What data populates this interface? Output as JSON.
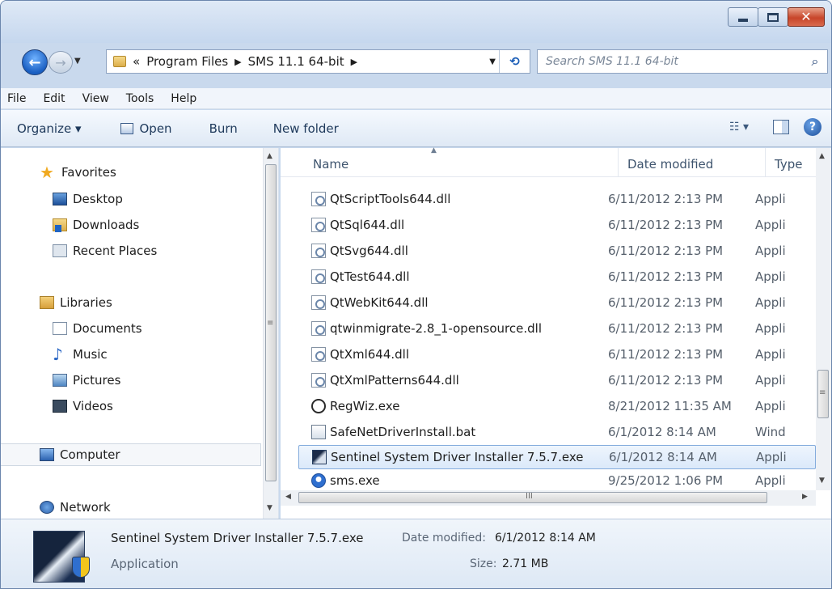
{
  "window": {
    "caption": {
      "minimize": "",
      "maximize": "",
      "close": "✕"
    }
  },
  "nav": {
    "back_glyph": "←",
    "forward_glyph": "→",
    "history_dropdown": "▼",
    "breadcrumb": {
      "overflow": "«",
      "items": [
        "Program Files",
        "SMS 11.1 64-bit"
      ],
      "separator": "▶"
    },
    "address_dropdown": "▼",
    "refresh_glyph": "⟲",
    "search_placeholder": "Search SMS 11.1 64-bit",
    "search_icon": "⌕"
  },
  "menu": {
    "items": [
      "File",
      "Edit",
      "View",
      "Tools",
      "Help"
    ]
  },
  "commands": {
    "organize": "Organize ▾",
    "open": "Open",
    "burn": "Burn",
    "new_folder": "New folder",
    "views_glyph": "☷ ▾",
    "help_glyph": "?"
  },
  "sidebar": {
    "favorites": {
      "label": "Favorites",
      "items": [
        "Desktop",
        "Downloads",
        "Recent Places"
      ]
    },
    "libraries": {
      "label": "Libraries",
      "items": [
        "Documents",
        "Music",
        "Pictures",
        "Videos"
      ]
    },
    "computer": "Computer",
    "network": "Network",
    "scroll_handle": "≡"
  },
  "files": {
    "columns": {
      "name": "Name",
      "date": "Date modified",
      "type": "Type"
    },
    "rows": [
      {
        "name": "QtScriptTools644.dll",
        "date": "6/11/2012 2:13 PM",
        "type": "Appli",
        "icon": "dll-icon"
      },
      {
        "name": "QtSql644.dll",
        "date": "6/11/2012 2:13 PM",
        "type": "Appli",
        "icon": "dll-icon"
      },
      {
        "name": "QtSvg644.dll",
        "date": "6/11/2012 2:13 PM",
        "type": "Appli",
        "icon": "dll-icon"
      },
      {
        "name": "QtTest644.dll",
        "date": "6/11/2012 2:13 PM",
        "type": "Appli",
        "icon": "dll-icon"
      },
      {
        "name": "QtWebKit644.dll",
        "date": "6/11/2012 2:13 PM",
        "type": "Appli",
        "icon": "dll-icon"
      },
      {
        "name": "qtwinmigrate-2.8_1-opensource.dll",
        "date": "6/11/2012 2:13 PM",
        "type": "Appli",
        "icon": "dll-icon"
      },
      {
        "name": "QtXml644.dll",
        "date": "6/11/2012 2:13 PM",
        "type": "Appli",
        "icon": "dll-icon"
      },
      {
        "name": "QtXmlPatterns644.dll",
        "date": "6/11/2012 2:13 PM",
        "type": "Appli",
        "icon": "dll-icon"
      },
      {
        "name": "RegWiz.exe",
        "date": "8/21/2012 11:35 AM",
        "type": "Appli",
        "icon": "regwiz-icon"
      },
      {
        "name": "SafeNetDriverInstall.bat",
        "date": "6/1/2012 8:14 AM",
        "type": "Wind",
        "icon": "batch-file-icon"
      },
      {
        "name": "Sentinel System Driver Installer 7.5.7.exe",
        "date": "6/1/2012 8:14 AM",
        "type": "Appli",
        "icon": "installer-icon",
        "selected": true
      },
      {
        "name": "sms.exe",
        "date": "9/25/2012 1:06 PM",
        "type": "Appli",
        "icon": "sms-app-icon"
      }
    ],
    "scroll_handle": "≡",
    "h_scroll_handle": "III"
  },
  "details": {
    "name": "Sentinel System Driver Installer 7.5.7.exe",
    "modified_label": "Date modified:",
    "modified_value": "6/1/2012 8:14 AM",
    "type": "Application",
    "size_label": "Size:",
    "size_value": "2.71 MB"
  }
}
